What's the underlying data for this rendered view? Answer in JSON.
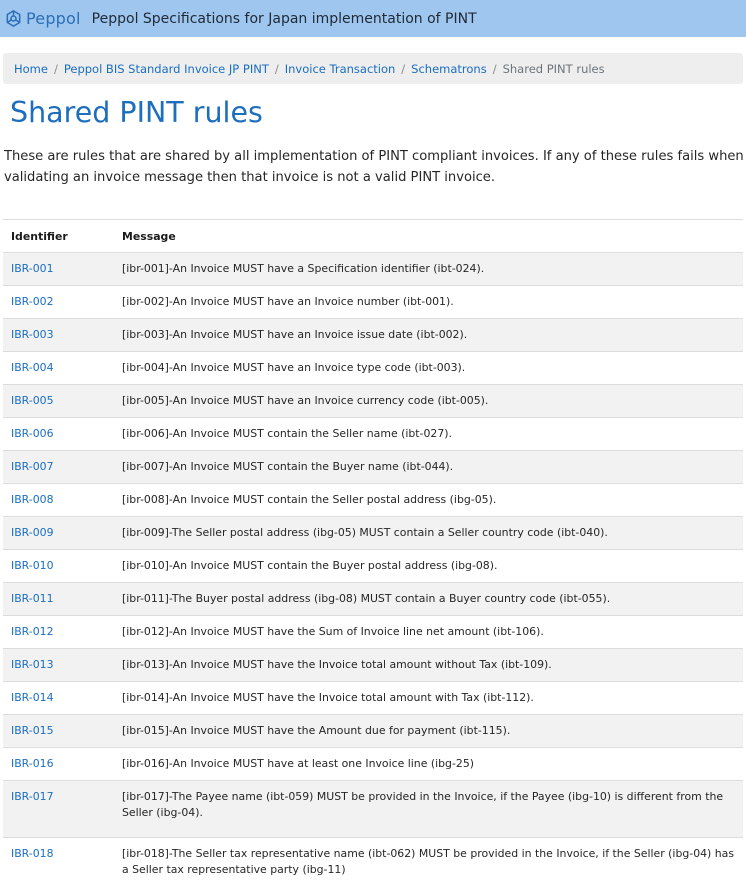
{
  "header": {
    "logo_text": "Peppol",
    "site_title": "Peppol Specifications for Japan implementation of PINT"
  },
  "breadcrumb": {
    "links": [
      "Home",
      "Peppol BIS Standard Invoice JP PINT",
      "Invoice Transaction",
      "Schematrons"
    ],
    "separator": "/",
    "current": "Shared PINT rules"
  },
  "page": {
    "title": "Shared PINT rules",
    "intro": "These are rules that are shared by all implementation of PINT compliant invoices. If any of these rules fails when validating an invoice message then that invoice is not a valid PINT invoice."
  },
  "table": {
    "headers": [
      "Identifier",
      "Message"
    ],
    "rows": [
      {
        "id": "IBR-001",
        "message": "[ibr-001]-An Invoice MUST have a Specification identifier (ibt-024)."
      },
      {
        "id": "IBR-002",
        "message": "[ibr-002]-An Invoice MUST have an Invoice number (ibt-001)."
      },
      {
        "id": "IBR-003",
        "message": "[ibr-003]-An Invoice MUST have an Invoice issue date (ibt-002)."
      },
      {
        "id": "IBR-004",
        "message": "[ibr-004]-An Invoice MUST have an Invoice type code (ibt-003)."
      },
      {
        "id": "IBR-005",
        "message": "[ibr-005]-An Invoice MUST have an Invoice currency code (ibt-005)."
      },
      {
        "id": "IBR-006",
        "message": "[ibr-006]-An Invoice MUST contain the Seller name (ibt-027)."
      },
      {
        "id": "IBR-007",
        "message": "[ibr-007]-An Invoice MUST contain the Buyer name (ibt-044)."
      },
      {
        "id": "IBR-008",
        "message": "[ibr-008]-An Invoice MUST contain the Seller postal address (ibg-05)."
      },
      {
        "id": "IBR-009",
        "message": "[ibr-009]-The Seller postal address (ibg-05) MUST contain a Seller country code (ibt-040)."
      },
      {
        "id": "IBR-010",
        "message": "[ibr-010]-An Invoice MUST contain the Buyer postal address (ibg-08)."
      },
      {
        "id": "IBR-011",
        "message": "[ibr-011]-The Buyer postal address (ibg-08) MUST contain a Buyer country code (ibt-055)."
      },
      {
        "id": "IBR-012",
        "message": "[ibr-012]-An Invoice MUST have the Sum of Invoice line net amount (ibt-106)."
      },
      {
        "id": "IBR-013",
        "message": "[ibr-013]-An Invoice MUST have the Invoice total amount without Tax (ibt-109)."
      },
      {
        "id": "IBR-014",
        "message": "[ibr-014]-An Invoice MUST have the Invoice total amount with Tax (ibt-112)."
      },
      {
        "id": "IBR-015",
        "message": "[ibr-015]-An Invoice MUST have the Amount due for payment (ibt-115)."
      },
      {
        "id": "IBR-016",
        "message": "[ibr-016]-An Invoice MUST have at least one Invoice line (ibg-25)"
      },
      {
        "id": "IBR-017",
        "message": "[ibr-017]-The Payee name (ibt-059) MUST be provided in the Invoice, if the Payee (ibg-10) is different from the Seller (ibg-04)."
      },
      {
        "id": "IBR-018",
        "message": "[ibr-018]-The Seller tax representative name (ibt-062) MUST be provided in the Invoice, if the Seller (ibg-04) has a Seller tax representative party (ibg-11)"
      }
    ]
  },
  "colors": {
    "header_bg": "#9fc6ef",
    "link": "#1a6ec0",
    "title": "#1d6fbd",
    "stripe": "#f2f2f2"
  },
  "icons": {
    "logo": "peppol-logo-icon"
  }
}
